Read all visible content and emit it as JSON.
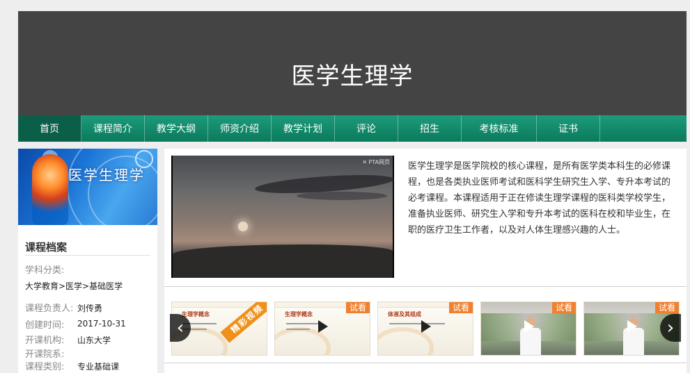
{
  "header": {
    "title": "医学生理学"
  },
  "nav": {
    "items": [
      {
        "label": "首页"
      },
      {
        "label": "课程简介"
      },
      {
        "label": "教学大纲"
      },
      {
        "label": "师资介绍"
      },
      {
        "label": "教学计划"
      },
      {
        "label": "评论"
      },
      {
        "label": "招生"
      },
      {
        "label": "考核标准"
      },
      {
        "label": "证书"
      }
    ],
    "active": "首页"
  },
  "sidebar": {
    "banner_text": "医学生理学",
    "archive_title": "课程档案",
    "fields": {
      "category_label": "学科分类:",
      "category_value": "大学教育>医学>基础医学",
      "lead_label": "课程负责人:",
      "lead_value": "刘传勇",
      "created_label": "创建时间:",
      "created_value": "2017-10-31",
      "org_label": "开课机构:",
      "org_value": "山东大学",
      "college_label": "开课院系:",
      "college_value": "",
      "type_label": "课程类别:",
      "type_value": "专业基础课"
    }
  },
  "video": {
    "watermark": "✕ PTA网页"
  },
  "description": "医学生理学是医学院校的核心课程，是所有医学类本科生的必修课程，也是各类执业医师考试和医科学生研究生入学、专升本考试的必考课程。本课程适用于正在修读生理学课程的医科类学校学生，准备执业医师、研究生入学和专升本考试的医科在校和毕业生，在职的医疗卫生工作者，以及对人体生理感兴趣的人士。",
  "carousel": {
    "items": [
      {
        "title": "生理学概念",
        "badge": "精彩视频"
      },
      {
        "title": "生理学概念",
        "badge": "试看"
      },
      {
        "title": "体液及其组成",
        "badge": "试看"
      },
      {
        "title": "",
        "badge": "试看"
      },
      {
        "title": "",
        "badge": "试看"
      }
    ],
    "prev_icon": "‹",
    "next_icon": "›"
  }
}
